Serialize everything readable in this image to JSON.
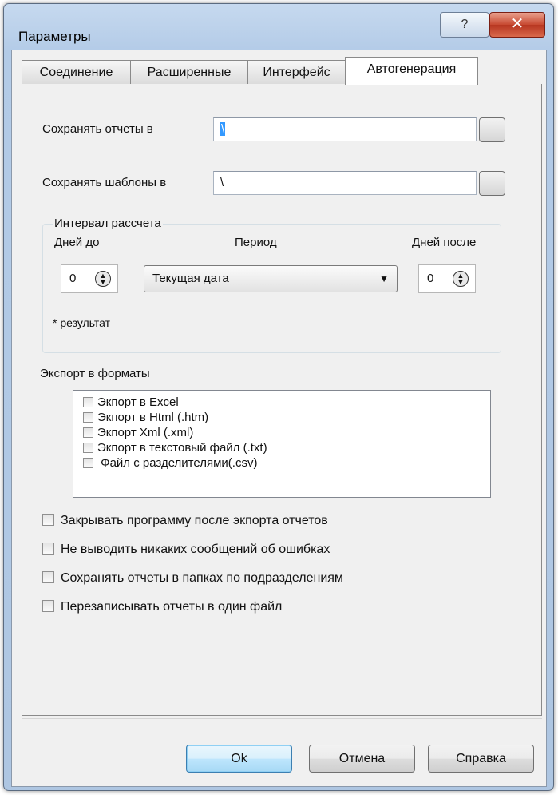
{
  "window": {
    "title": "Параметры",
    "help_glyph": "?",
    "close_glyph": "✕"
  },
  "tabs": [
    {
      "label": "Соединение",
      "active": false
    },
    {
      "label": "Расширенные",
      "active": false
    },
    {
      "label": "Интерфейс",
      "active": false
    },
    {
      "label": "Автогенерация",
      "active": true
    }
  ],
  "reports": {
    "label": "Сохранять отчеты в",
    "value": "\\"
  },
  "templates": {
    "label": "Сохранять шаблоны в",
    "value": "\\"
  },
  "interval": {
    "title": "Интервал рассчета",
    "days_before_label": "Дней до",
    "period_label": "Период",
    "days_after_label": "Дней после",
    "days_before_value": "0",
    "period_value": "Текущая дата",
    "days_after_value": "0",
    "result_label": "* результат"
  },
  "export": {
    "label": "Экспорт в форматы",
    "items": [
      {
        "label": "Экпорт в Excel",
        "checked": false
      },
      {
        "label": "Экпорт в Html  (.htm)",
        "checked": false
      },
      {
        "label": "Экпорт Xml  (.xml)",
        "checked": false
      },
      {
        "label": "Экпорт в текстовый файл (.txt)",
        "checked": false
      },
      {
        "label": " Файл с разделителями(.csv)",
        "checked": false
      }
    ]
  },
  "options": [
    {
      "label": "Закрывать программу после экпорта отчетов",
      "checked": false
    },
    {
      "label": "Не выводить никаких сообщений об ошибках",
      "checked": false
    },
    {
      "label": "Сохранять отчеты в папках по подразделениям",
      "checked": false
    },
    {
      "label": "Перезаписывать отчеты в один файл",
      "checked": false
    }
  ],
  "buttons": {
    "ok": "Ok",
    "cancel": "Отмена",
    "help": "Справка"
  }
}
